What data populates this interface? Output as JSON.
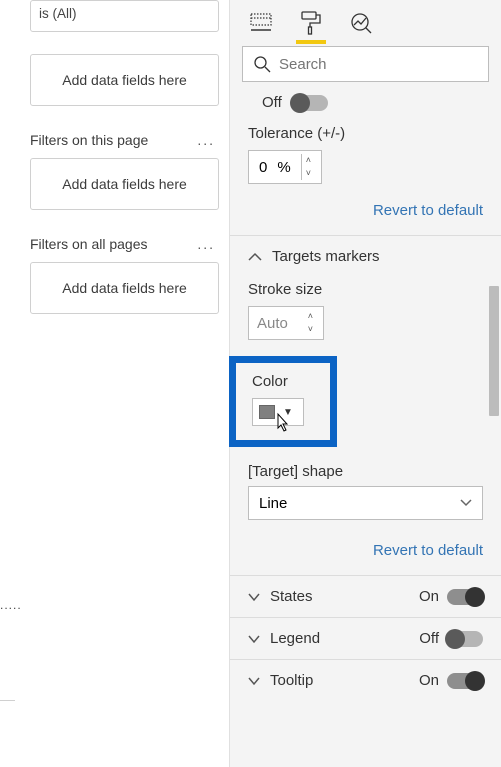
{
  "filters": {
    "card_is": "is (All)",
    "add_fields": "Add data fields here",
    "page_header": "Filters on this page",
    "all_header": "Filters on all pages"
  },
  "tabs": {
    "active": "format"
  },
  "search": {
    "placeholder": "Search"
  },
  "sync": {
    "label": "Off"
  },
  "tolerance": {
    "label": "Tolerance (+/-)",
    "value": "0",
    "unit": "%"
  },
  "revert": "Revert to default",
  "targets_markers": {
    "title": "Targets markers",
    "stroke_label": "Stroke size",
    "stroke_value": "Auto",
    "color_label": "Color",
    "color_value": "#808080",
    "shape_label": "[Target] shape",
    "shape_value": "Line"
  },
  "sections": {
    "states": {
      "label": "States",
      "switch": "On"
    },
    "legend": {
      "label": "Legend",
      "switch": "Off"
    },
    "tooltip": {
      "label": "Tooltip",
      "switch": "On"
    }
  }
}
